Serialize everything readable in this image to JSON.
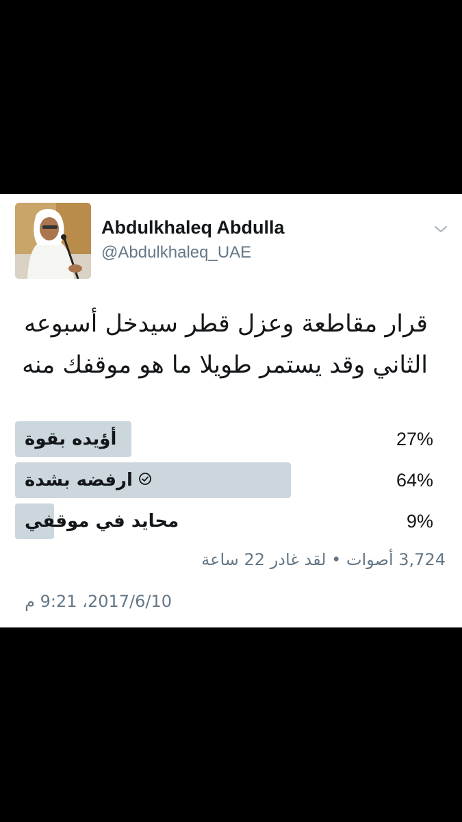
{
  "tweet": {
    "display_name": "Abdulkhaleq Abdulla",
    "handle": "@Abdulkhaleq_UAE",
    "text_lines": [
      "قرار مقاطعة وعزل قطر سيدخل أسبوعه",
      "الثاني وقد يستمر طويلا ما هو موقفك منه"
    ],
    "timestamp": "2017/6/10، 9:21 م"
  },
  "poll": {
    "options": [
      {
        "label": "أؤيده بقوة",
        "percent_text": "27%",
        "fraction": 0.27,
        "selected": false
      },
      {
        "label": "ارفضه بشدة",
        "percent_text": "64%",
        "fraction": 0.64,
        "selected": true
      },
      {
        "label": "محايد في موقفي",
        "percent_text": "9%",
        "fraction": 0.09,
        "selected": false
      }
    ],
    "meta": "3,724 أصوات • لقد غادر 22 ساعة"
  },
  "icons": {
    "chevron": "chevron-down-icon",
    "check": "check-circle-icon"
  },
  "colors": {
    "bar": "#ccd6dd",
    "text": "#14171a",
    "secondary": "#657786"
  }
}
